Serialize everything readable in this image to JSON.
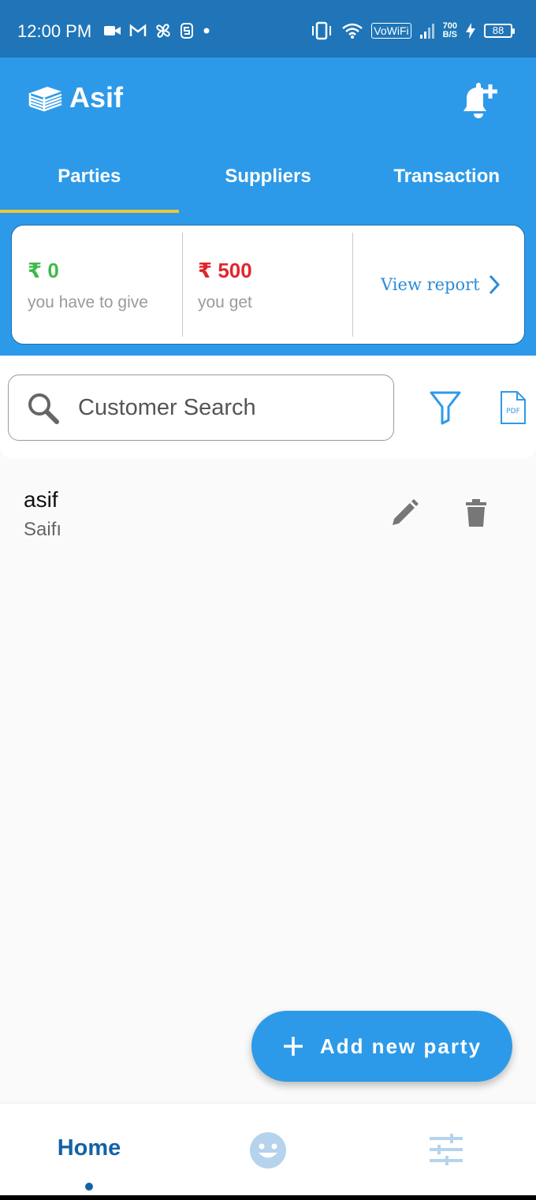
{
  "status_bar": {
    "time": "12:00 PM",
    "network_label": "VoWiFi",
    "speed_value": "700",
    "speed_unit": "B/S",
    "battery": "88"
  },
  "header": {
    "title": "Asif"
  },
  "tabs": [
    {
      "label": "Parties",
      "active": true
    },
    {
      "label": "Suppliers",
      "active": false
    },
    {
      "label": "Transaction",
      "active": false
    }
  ],
  "summary": {
    "give": {
      "amount": "₹ 0",
      "label": "you have to give",
      "color": "#3dba4a"
    },
    "get": {
      "amount": "₹ 500",
      "label": "you get",
      "color": "#e0262c"
    },
    "report_label": "View report"
  },
  "search": {
    "placeholder": "Customer Search"
  },
  "pdf_icon_text": "PDF",
  "parties": [
    {
      "name": "asif",
      "subtitle": "Saifı"
    }
  ],
  "fab": {
    "label": "Add new party"
  },
  "bottom_nav": {
    "home_label": "Home"
  },
  "colors": {
    "primary": "#2d9ae9",
    "status_bar": "#1f75b7",
    "tab_indicator": "#f2c633",
    "nav_active": "#1462a4"
  }
}
